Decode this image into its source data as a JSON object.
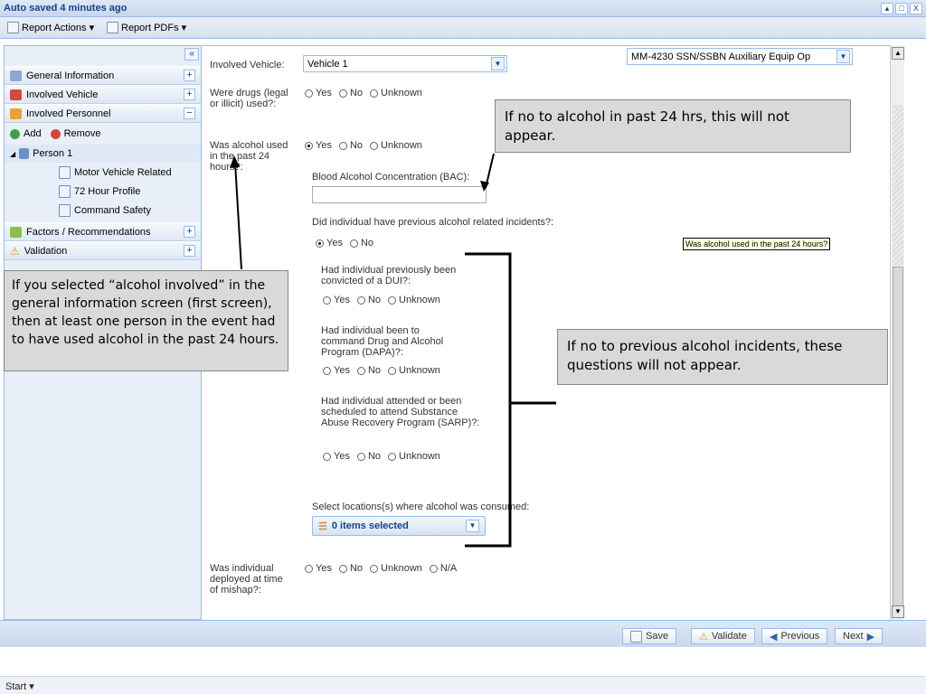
{
  "window": {
    "title": "Auto saved 4 minutes ago",
    "buttons": [
      "▴",
      "□",
      "X"
    ]
  },
  "toolbar": {
    "report_actions": "Report Actions ▾",
    "report_pdfs": "Report PDFs ▾"
  },
  "sidebar": {
    "collapse": "«",
    "items": [
      {
        "label": "General Information",
        "toggle": "+"
      },
      {
        "label": "Involved Vehicle",
        "toggle": "+"
      },
      {
        "label": "Involved Personnel",
        "toggle": "−"
      }
    ],
    "add_label": "Add",
    "remove_label": "Remove",
    "person": "Person 1",
    "person_children": [
      "Motor Vehicle Related",
      "72 Hour Profile",
      "Command Safety"
    ],
    "factors": {
      "label": "Factors / Recommendations",
      "toggle": "+"
    },
    "validation": {
      "label": "Validation",
      "toggle": "+"
    }
  },
  "form": {
    "involved_vehicle_label": "Involved Vehicle:",
    "involved_vehicle_value": "Vehicle 1",
    "rating_value": "MM-4230 SSN/SSBN Auxiliary Equip Op",
    "drugs_label": "Were drugs (legal or illicit) used?:",
    "alcohol_label": "Was alcohol used in the past 24 hours?:",
    "bac_label": "Blood Alcohol Concentration (BAC):",
    "prev_incidents_label": "Did individual have previous alcohol related incidents?:",
    "dui_label": "Had individual previously been convicted of a DUI?:",
    "dapa_label": "Had individual been to command Drug and Alcohol Program (DAPA)?:",
    "sarp_label": "Had individual attended or been scheduled to attend Substance Abuse Recovery Program (SARP)?:",
    "locations_label": "Select locations(s) where alcohol was consumed:",
    "locations_value": "0 items selected",
    "deployed_label": "Was individual deployed at time of mishap?:",
    "yes": "Yes",
    "no": "No",
    "unknown": "Unknown",
    "na": "N/A",
    "tooltip": "Was alcohol used in the past 24 hours?"
  },
  "callouts": {
    "alcohol_24": "If no to alcohol in past 24 hrs, this will not appear.",
    "general_info": "If you selected “alcohol involved” in the general information screen (first screen), then at least one person in the event had to have used alcohol in the past 24 hours.",
    "previous": "If no to previous alcohol incidents, these questions will not appear."
  },
  "footer": {
    "save": "Save",
    "validate": "Validate",
    "previous": "Previous",
    "next": "Next"
  },
  "status": {
    "start": "Start ▾"
  }
}
